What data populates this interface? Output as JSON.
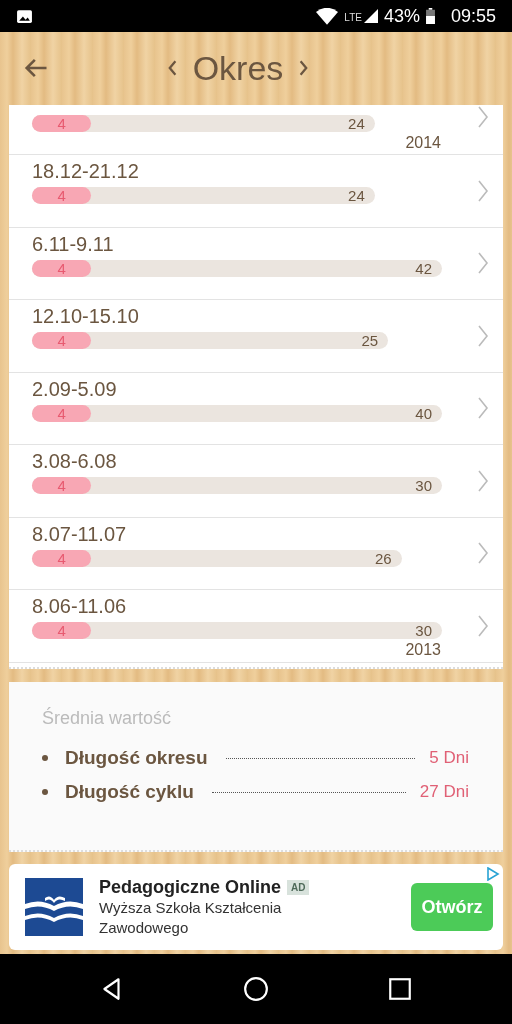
{
  "status_bar": {
    "battery": "43%",
    "time": "09:55",
    "network": "LTE"
  },
  "header": {
    "title": "Okres"
  },
  "periods": [
    {
      "period": {
        "value": "4",
        "level": 0.145
      },
      "cycle": {
        "value": "24"
      },
      "year": "2014"
    },
    {
      "date": "18.12-21.12",
      "period": {
        "value": "4",
        "level": 0.145
      },
      "cycle": {
        "value": "24"
      }
    },
    {
      "date": "6.11-9.11",
      "period": {
        "value": "4",
        "level": 0.145
      },
      "cycle": {
        "value": "42"
      }
    },
    {
      "date": "12.10-15.10",
      "period": {
        "value": "4",
        "level": 0.145
      },
      "cycle": {
        "value": "25"
      }
    },
    {
      "date": "2.09-5.09",
      "period": {
        "value": "4",
        "level": 0.145
      },
      "cycle": {
        "value": "40"
      }
    },
    {
      "date": "3.08-6.08",
      "period": {
        "value": "4",
        "level": 0.145
      },
      "cycle": {
        "value": "30"
      }
    },
    {
      "date": "8.07-11.07",
      "period": {
        "value": "4",
        "level": 0.145
      },
      "cycle": {
        "value": "26"
      }
    },
    {
      "date": "8.06-11.06",
      "period": {
        "value": "4",
        "level": 0.145
      },
      "cycle": {
        "value": "30"
      },
      "year": "2013"
    }
  ],
  "summary": {
    "title": "Średnia wartość",
    "items": [
      {
        "label": "Długość okresu",
        "value": "5 Dni"
      },
      {
        "label": "Długość cyklu",
        "value": "27 Dni"
      }
    ]
  },
  "ad": {
    "title": "Pedagogiczne Online",
    "badge": "AD",
    "text": "Wyższa Szkoła Kształcenia Zawodowego",
    "button": "Otwórz"
  }
}
